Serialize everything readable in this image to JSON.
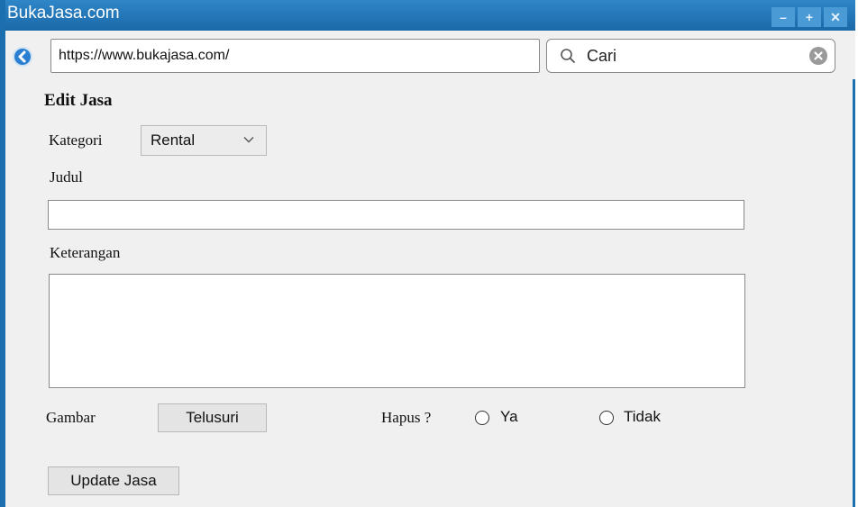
{
  "window": {
    "title": "BukaJasa.com",
    "minimize_glyph": "–",
    "maximize_glyph": "+",
    "close_glyph": "✕"
  },
  "browser": {
    "url": "https://www.bukajasa.com/",
    "search_value": "Cari"
  },
  "form": {
    "heading": "Edit Jasa",
    "kategori_label": "Kategori",
    "kategori_value": "Rental",
    "judul_label": "Judul",
    "judul_value": "",
    "keterangan_label": "Keterangan",
    "keterangan_value": "",
    "gambar_label": "Gambar",
    "telusuri_button": "Telusuri",
    "hapus_label": "Hapus ?",
    "radio_ya": "Ya",
    "radio_tidak": "Tidak",
    "submit_button": "Update Jasa"
  },
  "colors": {
    "titlebar": "#1b6fae",
    "window_bg": "#f0f0f0"
  },
  "icons": [
    "back-arrow-icon",
    "search-icon",
    "clear-icon",
    "chevron-down-icon"
  ]
}
